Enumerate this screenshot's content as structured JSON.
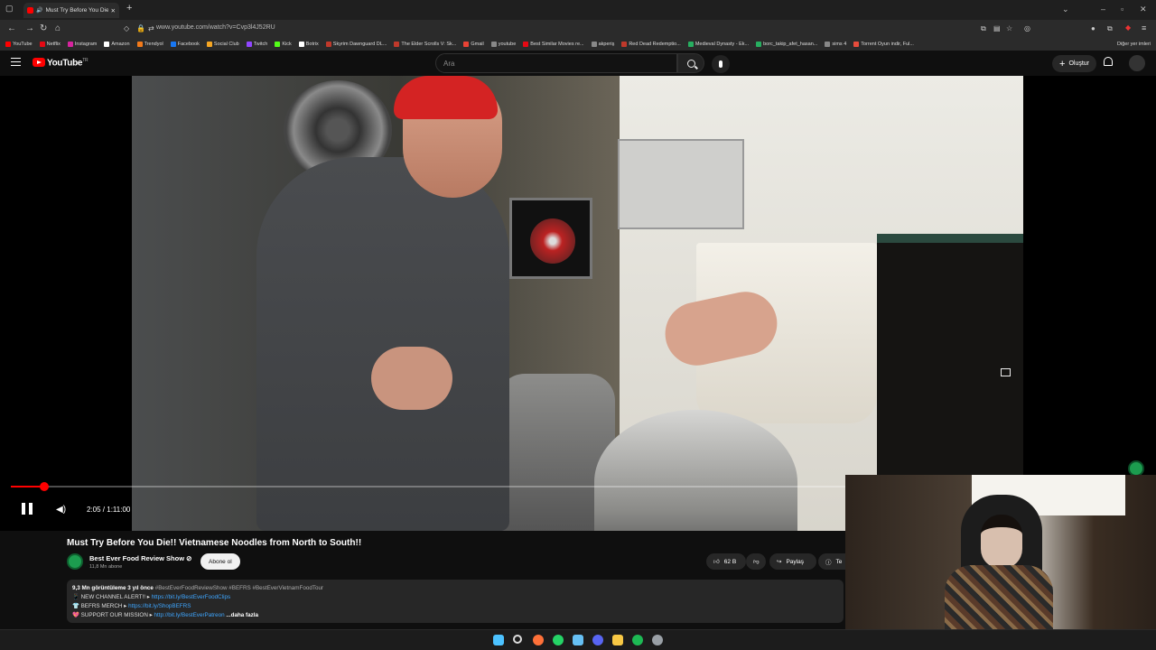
{
  "browser": {
    "tab_title": "Must Try Before You Die!! Vi",
    "url": "www.youtube.com/watch?v=Cvp3l4J52RU",
    "bookmarks": [
      {
        "label": "YouTube",
        "color": "#ff0000"
      },
      {
        "label": "Netflix",
        "color": "#e50914"
      },
      {
        "label": "Instagram",
        "color": "#d6249f"
      },
      {
        "label": "Amazon",
        "color": "#ffffff"
      },
      {
        "label": "Trendyol",
        "color": "#f27a1a"
      },
      {
        "label": "Facebook",
        "color": "#1877f2"
      },
      {
        "label": "Social Club",
        "color": "#f5a623"
      },
      {
        "label": "Twitch",
        "color": "#9146ff"
      },
      {
        "label": "Kick",
        "color": "#53fc18"
      },
      {
        "label": "Botrix",
        "color": "#ffffff"
      },
      {
        "label": "Skyrim Dawnguard DL...",
        "color": "#c0392b"
      },
      {
        "label": "The Elder Scrolls V: Sk...",
        "color": "#c0392b"
      },
      {
        "label": "Gmail",
        "color": "#ea4335"
      },
      {
        "label": "youtube",
        "color": "#888888"
      },
      {
        "label": "Best Similar Movies re...",
        "color": "#e50914"
      },
      {
        "label": "akperiş",
        "color": "#888888"
      },
      {
        "label": "Red Dead Redemptio...",
        "color": "#c0392b"
      },
      {
        "label": "Medieval Dynasty - Ek...",
        "color": "#27ae60"
      },
      {
        "label": "borc_takip_afet_hasan...",
        "color": "#27ae60"
      },
      {
        "label": "sims 4",
        "color": "#888888"
      },
      {
        "label": "Torrent Oyun indir, Ful...",
        "color": "#e74c3c"
      }
    ],
    "other_bookmarks": "Diğer yer imleri"
  },
  "youtube": {
    "logo_text": "YouTube",
    "logo_region": "TR",
    "search_placeholder": "Ara",
    "create_label": "Oluştur"
  },
  "player": {
    "time": "2:05 / 1:11:00",
    "progress_fraction": 0.04
  },
  "video": {
    "title": "Must Try Before You Die!! Vietnamese Noodles from North to South!!",
    "channel_name": "Best Ever Food Review Show ⊘",
    "channel_subs": "11,8 Mn abone",
    "subscribe_label": "Abone ol",
    "likes": "62 B",
    "share_label": "Paylaş",
    "thanks_label": "Te",
    "description": {
      "meta": "9,3 Mn görüntüleme  3 yıl önce",
      "hashtags": "#BestEverFoodReviewShow #BEFRS #BestEverVietnamFoodTour",
      "line1_label": "📱 NEW CHANNEL ALERT!! ▸",
      "line1_link": "https://bit.ly/BestEverFoodClips",
      "line2_label": "👕 BEFRS MERCH ▸",
      "line2_link": "https://bit.ly/ShopBEFRS",
      "line3_label": "💖 SUPPORT OUR MISSION ▸",
      "line3_link": "http://bit.ly/BestEverPatreon",
      "more": "...daha fazla"
    }
  },
  "taskbar": {
    "icons": [
      {
        "name": "windows-start-icon",
        "color": "#4cc2ff"
      },
      {
        "name": "search-icon",
        "color": "#dddddd"
      },
      {
        "name": "firefox-icon",
        "color": "#ff7139"
      },
      {
        "name": "whatsapp-icon",
        "color": "#25d366"
      },
      {
        "name": "steam-icon",
        "color": "#66c0f4"
      },
      {
        "name": "discord-icon",
        "color": "#5865f2"
      },
      {
        "name": "file-explorer-icon",
        "color": "#f8c845"
      },
      {
        "name": "spotify-icon",
        "color": "#1db954"
      },
      {
        "name": "settings-icon",
        "color": "#9aa0a6"
      }
    ]
  }
}
